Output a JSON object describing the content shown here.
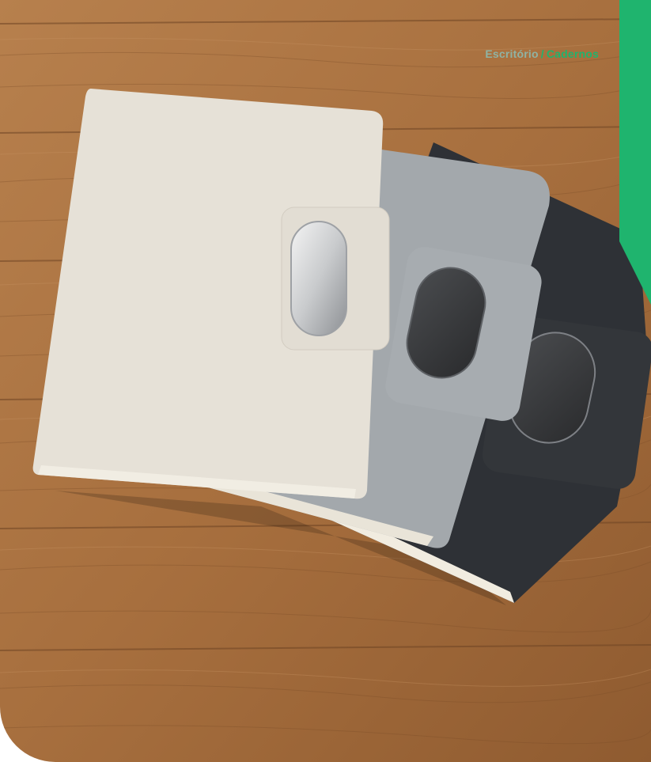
{
  "breadcrumb": {
    "parent": "Escritório",
    "separator": "/",
    "current": "Cadernos"
  },
  "colors": {
    "accent": "#1fb46e",
    "wood": "#b27a48",
    "notebook_cream": "#e6e1d7",
    "notebook_grey": "#a3a8ac",
    "notebook_dark": "#2e3136"
  },
  "image": {
    "subject": "three-notebooks-on-wood-icon"
  }
}
